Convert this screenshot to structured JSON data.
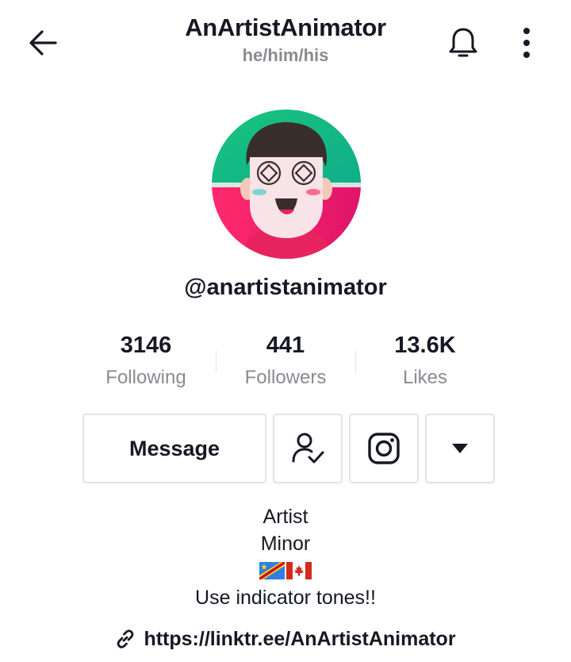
{
  "header": {
    "title": "AnArtistAnimator",
    "pronouns": "he/him/his",
    "back_icon": "arrow-left-icon",
    "bell_icon": "bell-icon",
    "more_icon": "more-vertical-icon"
  },
  "profile": {
    "username": "@anartistanimator",
    "avatar_colors": {
      "top": "#19c37d",
      "bottom": "#ff2a6d"
    }
  },
  "stats": [
    {
      "value": "3146",
      "label": "Following"
    },
    {
      "value": "441",
      "label": "Followers"
    },
    {
      "value": "13.6K",
      "label": "Likes"
    }
  ],
  "actions": {
    "message_label": "Message",
    "follow_icon": "user-check-icon",
    "instagram_icon": "instagram-icon",
    "dropdown_icon": "triangle-down-icon"
  },
  "bio": {
    "line1": "Artist",
    "line2": "Minor",
    "flags": [
      "DR Congo flag",
      "Canada flag"
    ],
    "line3": "Use indicator tones!!"
  },
  "link": {
    "icon": "link-icon",
    "url": "https://linktr.ee/AnArtistAnimator"
  },
  "colors": {
    "text_primary": "#161823",
    "text_secondary": "#8a8b91",
    "border": "#e3e3e4"
  }
}
